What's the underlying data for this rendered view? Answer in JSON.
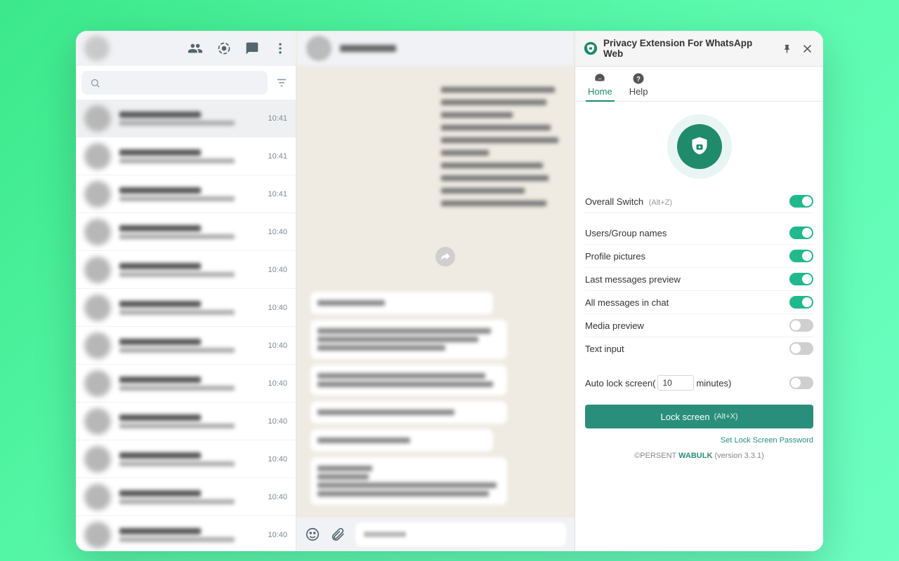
{
  "extension": {
    "title": "Privacy Extension For WhatsApp Web",
    "tabs": {
      "home": "Home",
      "help": "Help"
    },
    "overall": {
      "label": "Overall Switch",
      "hint": "(Alt+Z)",
      "on": true
    },
    "settings": [
      {
        "label": "Users/Group names",
        "on": true
      },
      {
        "label": "Profile pictures",
        "on": true
      },
      {
        "label": "Last messages preview",
        "on": true
      },
      {
        "label": "All messages in chat",
        "on": true
      },
      {
        "label": "Media preview",
        "on": false
      },
      {
        "label": "Text input",
        "on": false
      }
    ],
    "autolock": {
      "prefix": "Auto lock screen(",
      "value": "10",
      "suffix": "minutes)",
      "on": false
    },
    "lockButton": {
      "label": "Lock screen",
      "hint": "(Alt+X)"
    },
    "setPassword": "Set Lock Screen Password",
    "footer": {
      "prefix": "©PERSENT ",
      "brand": "WABULK",
      "version": " (version 3.3.1)"
    }
  },
  "chatTimes": [
    "10:41",
    "10:41",
    "10:41",
    "10:40",
    "10:40",
    "10:40",
    "10:40",
    "10:40",
    "10:40",
    "10:40",
    "10:40",
    "10:40"
  ]
}
